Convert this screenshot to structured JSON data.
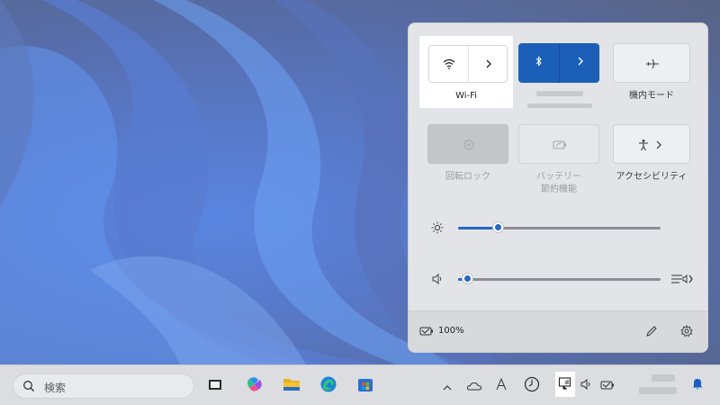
{
  "quick_settings": {
    "wifi": {
      "label": "Wi-Fi",
      "icon": "wifi-icon",
      "state": "on"
    },
    "bluetooth": {
      "icon": "bluetooth-icon",
      "state": "on"
    },
    "airplane": {
      "label": "機内モード",
      "icon": "airplane-icon"
    },
    "rotation_lock": {
      "label": "回転ロック",
      "icon": "rotation-lock-icon"
    },
    "battery_saver": {
      "label_line1": "バッテリー",
      "label_line2": "節約機能",
      "icon": "battery-saver-icon"
    },
    "accessibility": {
      "label": "アクセシビリティ",
      "icon": "accessibility-icon"
    },
    "brightness": {
      "icon": "brightness-icon",
      "level": 0.2
    },
    "volume": {
      "icon": "speaker-icon",
      "level": 0.05
    },
    "footer": {
      "battery_text": "100%",
      "edit_icon": "pencil-icon",
      "settings_icon": "gear-icon"
    }
  },
  "taskbar": {
    "search_placeholder": "検索",
    "apps": [
      "task-view-icon",
      "copilot-icon",
      "file-explorer-icon",
      "edge-icon",
      "store-icon"
    ],
    "tray": [
      "chevron-up-icon",
      "onedrive-icon",
      "ime-a-icon",
      "clock-app-icon",
      "network-icon",
      "speaker-icon",
      "battery-icon",
      "bell-icon"
    ]
  },
  "colors": {
    "accent": "#1c5fb8",
    "panel": "#e3e4e8"
  }
}
